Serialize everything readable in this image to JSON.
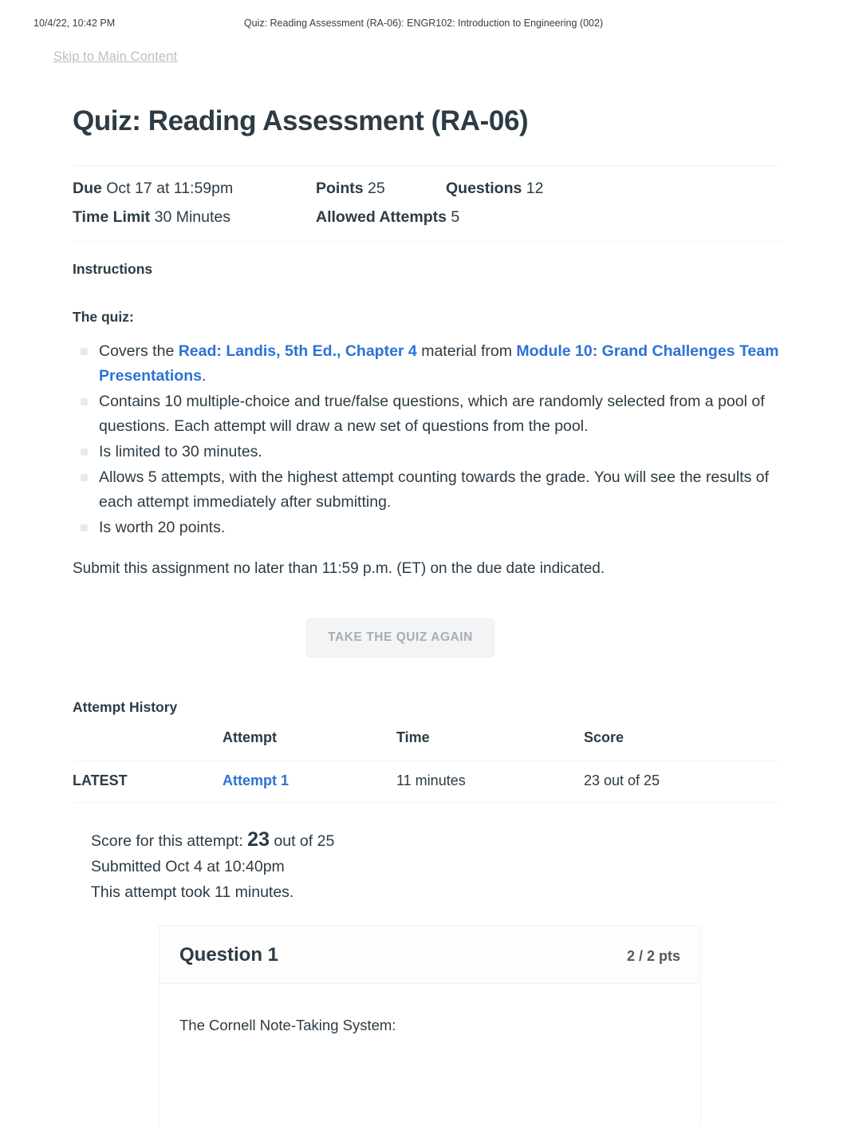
{
  "print_header": {
    "date": "10/4/22, 10:42 PM",
    "title": "Quiz: Reading Assessment (RA-06): ENGR102: Introduction to Engineering (002)"
  },
  "skip_link": {
    "label": "Skip to Main Content"
  },
  "page_title": "Quiz: Reading Assessment (RA-06)",
  "meta": {
    "due_label": "Due",
    "due_value": "Oct 17 at 11:59pm",
    "points_label": "Points",
    "points_value": "25",
    "questions_label": "Questions",
    "questions_value": "12",
    "time_limit_label": "Time Limit",
    "time_limit_value": "30 Minutes",
    "allowed_attempts_label": "Allowed Attempts",
    "allowed_attempts_value": "5"
  },
  "instructions": {
    "heading": "Instructions",
    "lead": "The quiz:",
    "items": [
      {
        "parts": [
          {
            "type": "text",
            "text": "Covers the "
          },
          {
            "type": "link",
            "text": "Read: Landis, 5th Ed., Chapter 4"
          },
          {
            "type": "text",
            "text": " material from "
          },
          {
            "type": "link",
            "text": "Module 10: Grand Challenges Team Presentations"
          },
          {
            "type": "text",
            "text": "."
          }
        ]
      },
      {
        "parts": [
          {
            "type": "text",
            "text": "Contains 10 multiple-choice and true/false questions, which are randomly selected from a pool of questions. Each attempt will draw a new set of questions from the pool."
          }
        ]
      },
      {
        "parts": [
          {
            "type": "text",
            "text": "Is limited to 30 minutes."
          }
        ]
      },
      {
        "parts": [
          {
            "type": "text",
            "text": "Allows 5 attempts, with the highest attempt counting towards the grade. You will see the results of each attempt immediately after submitting."
          }
        ]
      },
      {
        "parts": [
          {
            "type": "text",
            "text": "Is worth 20 points."
          }
        ]
      }
    ],
    "submit_note": "Submit this assignment no later than 11:59 p.m. (ET) on the due date indicated."
  },
  "take_again_button": {
    "label": "TAKE THE QUIZ AGAIN"
  },
  "attempt_history": {
    "heading": "Attempt History",
    "columns": [
      "",
      "Attempt",
      "Time",
      "Score"
    ],
    "rows": [
      {
        "flag": "LATEST",
        "attempt": "Attempt 1",
        "time": "11 minutes",
        "score": "23 out of 25"
      }
    ]
  },
  "result": {
    "score_prefix": "Score for this attempt:",
    "score_value": "23",
    "score_suffix": "out of 25",
    "submitted": "Submitted Oct 4 at 10:40pm",
    "duration": "This attempt took 11 minutes."
  },
  "question": {
    "title": "Question 1",
    "points": "2 / 2 pts",
    "text": "The Cornell Note-Taking System:"
  },
  "colors": {
    "link": "#2b72d6",
    "text": "#2d3b45",
    "muted": "#bcbfc2",
    "rule": "#f2f3f4",
    "button_bg": "#f2f4f5",
    "button_text": "#a9adb1"
  }
}
